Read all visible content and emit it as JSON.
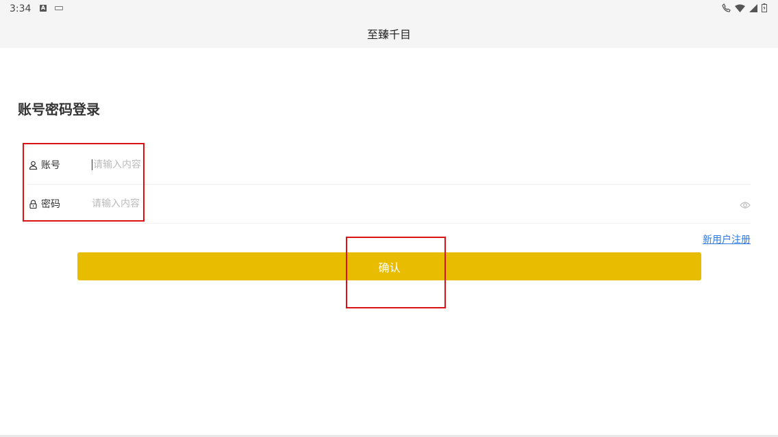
{
  "status_bar": {
    "time": "3:34",
    "icons": [
      "notification-a-icon",
      "keyboard-icon",
      "call-icon",
      "wifi-icon",
      "signal-icon",
      "battery-icon"
    ]
  },
  "header": {
    "title": "至臻千目"
  },
  "login": {
    "heading": "账号密码登录",
    "account": {
      "label": "账号",
      "placeholder": "请输入内容",
      "icon": "user-icon"
    },
    "password": {
      "label": "密码",
      "placeholder": "请输入内容",
      "icon": "lock-icon",
      "toggle_icon": "eye-icon"
    },
    "register_link": "新用户注册",
    "confirm_label": "确认"
  },
  "colors": {
    "accent": "#e8bc00",
    "link": "#2a7ae2",
    "annotation": "#dd1111"
  }
}
